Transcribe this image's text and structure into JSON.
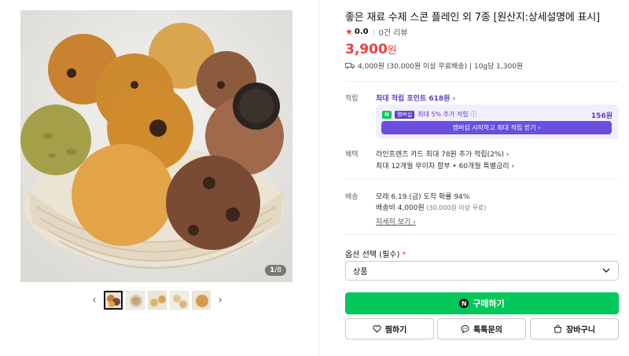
{
  "gallery": {
    "counter_current": "1",
    "counter_total": "/8",
    "prev_icon": "chevron-left-icon",
    "next_icon": "chevron-right-icon"
  },
  "product": {
    "title": "좋은 재료 수제 스콘 플레인 외 7종 [원산지:상세설명에 표시]",
    "rating": "0.0",
    "reviews": "0건 리뷰",
    "price": "3,900",
    "price_unit": "원",
    "shipping_summary": "4,000원 (30,000원 이상 무료배송) | 10g당 1,300원"
  },
  "points": {
    "label": "적립",
    "max_point_link": "최대 적립 포인트 618원 ›",
    "npay_badge": "N",
    "plus_badge": "멤버십",
    "extra_text": "최대 5% 추가 적립 ⓘ",
    "extra_amount": "156원",
    "member_button": "멤버십 시작하고 최대 적립 받기 ›"
  },
  "benefits": {
    "label": "혜택",
    "line1": "라인프렌즈 카드 최대 78원 추가 적립(2%) ›",
    "line2": "최대 12개월 무이자 할부 • 60개월 특별금리 ›"
  },
  "delivery": {
    "label": "배송",
    "line1": "모레 6.19.(금) 도착 확률 94%",
    "line2": "배송비 4,000원",
    "line2_note": " (30,000원 이상 무료)",
    "detail_link": "자세히 보기 ›"
  },
  "option": {
    "label": "옵션 선택 (필수)",
    "required_mark": " *",
    "selected": "상품"
  },
  "actions": {
    "buy": "구매하기",
    "buy_icon_text": "N",
    "wish": "찜하기",
    "talk": "톡톡문의",
    "cart": "장바구니"
  },
  "colors": {
    "price_red": "#f03e3e",
    "naver_green": "#03c75a",
    "membership_purple": "#6b4de0"
  }
}
